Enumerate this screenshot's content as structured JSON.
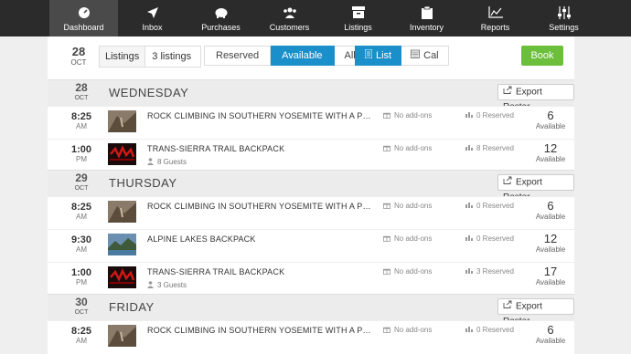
{
  "nav": [
    {
      "label": "Dashboard",
      "icon": "dashboard-icon",
      "active": true
    },
    {
      "label": "Inbox",
      "icon": "send-icon"
    },
    {
      "label": "Purchases",
      "icon": "piggy-bank-icon"
    },
    {
      "label": "Customers",
      "icon": "users-icon"
    },
    {
      "label": "Listings",
      "icon": "archive-icon"
    },
    {
      "label": "Inventory",
      "icon": "clipboard-icon"
    },
    {
      "label": "Reports",
      "icon": "line-chart-icon"
    },
    {
      "label": "Settings",
      "icon": "sliders-icon"
    }
  ],
  "toolbar": {
    "date_day": "28",
    "date_month": "OCT",
    "listings_label": "Listings",
    "listings_value": "3 listings",
    "filter": [
      "Reserved",
      "Available",
      "All"
    ],
    "view": [
      "List",
      "Cal"
    ],
    "book_label": "Book"
  },
  "colors": {
    "accent": "#1a8fc9",
    "book": "#6bbf3b",
    "nav_bg": "#2b2b2b"
  },
  "export_label": "Export Roster",
  "available_label": "Available",
  "days": [
    {
      "day": "28",
      "month": "OCT",
      "name": "WEDNESDAY",
      "rows": [
        {
          "time": "8:25",
          "ampm": "AM",
          "title": "ROCK CLIMBING IN SOUTHERN YOSEMITE WITH A PRIVATE GUIDE",
          "guests": "",
          "addons": "No add-ons",
          "reserved": "0 Reserved",
          "available": "6"
        },
        {
          "time": "1:00",
          "ampm": "PM",
          "title": "TRANS-SIERRA TRAIL BACKPACK",
          "guests": "8 Guests",
          "addons": "No add-ons",
          "reserved": "8 Reserved",
          "available": "12"
        }
      ]
    },
    {
      "day": "29",
      "month": "OCT",
      "name": "THURSDAY",
      "rows": [
        {
          "time": "8:25",
          "ampm": "AM",
          "title": "ROCK CLIMBING IN SOUTHERN YOSEMITE WITH A PRIVATE GUIDE",
          "guests": "",
          "addons": "No add-ons",
          "reserved": "0 Reserved",
          "available": "6"
        },
        {
          "time": "9:30",
          "ampm": "AM",
          "title": "ALPINE LAKES BACKPACK",
          "guests": "",
          "addons": "No add-ons",
          "reserved": "0 Reserved",
          "available": "12"
        },
        {
          "time": "1:00",
          "ampm": "PM",
          "title": "TRANS-SIERRA TRAIL BACKPACK",
          "guests": "3 Guests",
          "addons": "No add-ons",
          "reserved": "3 Reserved",
          "available": "17"
        }
      ]
    },
    {
      "day": "30",
      "month": "OCT",
      "name": "FRIDAY",
      "rows": [
        {
          "time": "8:25",
          "ampm": "AM",
          "title": "ROCK CLIMBING IN SOUTHERN YOSEMITE WITH A PRIVATE GUIDE",
          "guests": "",
          "addons": "No add-ons",
          "reserved": "0 Reserved",
          "available": "6"
        }
      ]
    }
  ]
}
